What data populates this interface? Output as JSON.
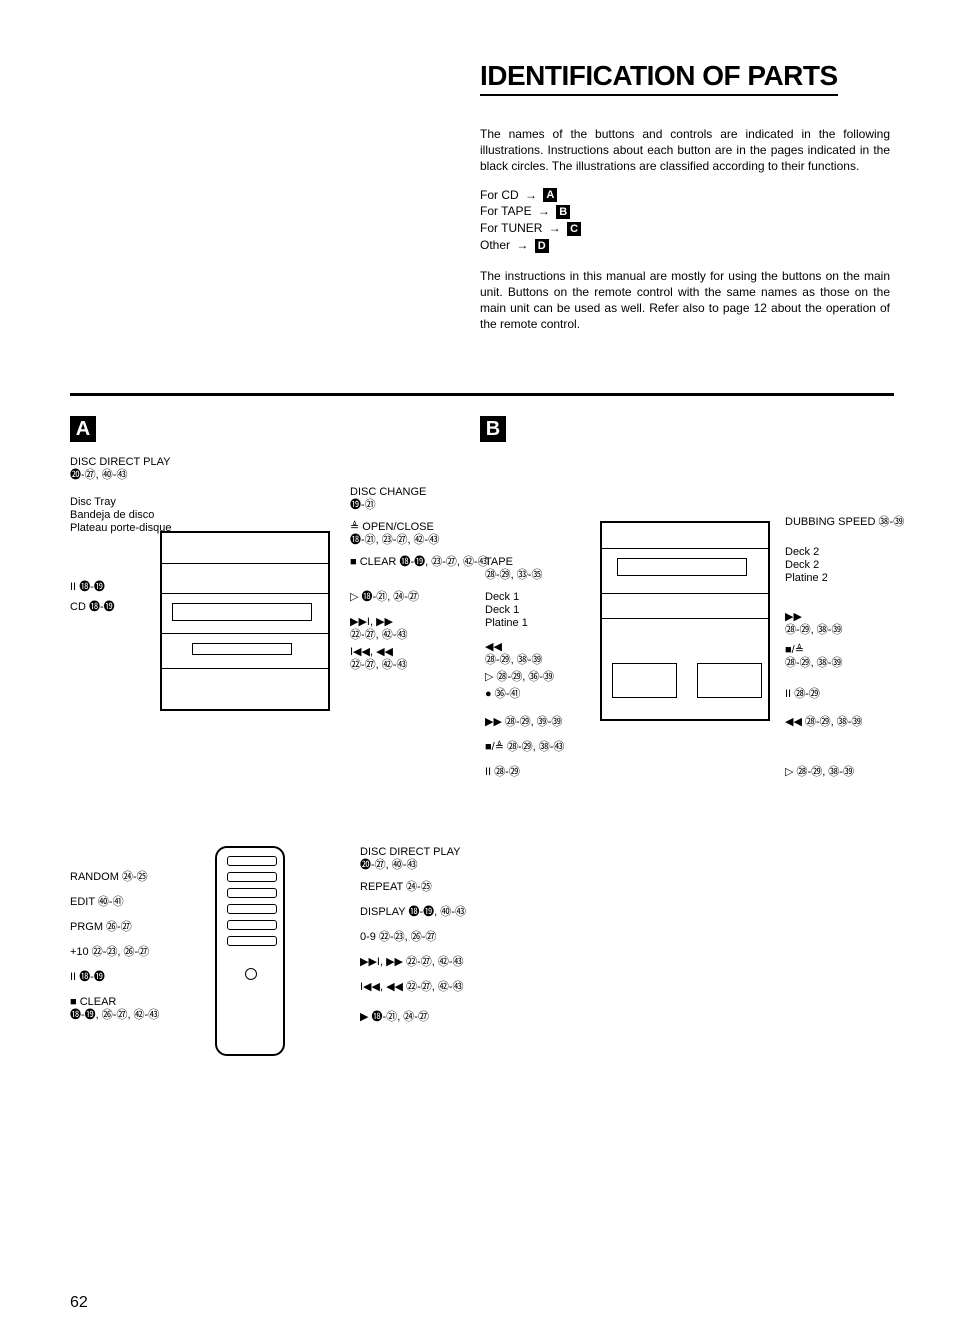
{
  "title": "IDENTIFICATION OF PARTS",
  "intro_p1": "The names of the buttons and controls are indicated in the following illustrations. Instructions about each button are in the pages indicated in the black circles. The illustrations are classified according to their functions.",
  "legend": {
    "cd": "For CD",
    "tape": "For TAPE",
    "tuner": "For TUNER",
    "other": "Other"
  },
  "intro_p2": "The instructions in this manual are mostly for using the buttons on the main unit. Buttons on the remote control with the same names as those on the main unit can be used as well. Refer also to page 12 about the operation of the remote control.",
  "sections": {
    "a": "A",
    "b": "B"
  },
  "labels_a": {
    "disc_direct_play": "DISC DIRECT PLAY",
    "disc_tray": "Disc Tray",
    "bandeja": "Bandeja de disco",
    "plateau": "Plateau porte-disque",
    "pause": "II",
    "cd": "CD",
    "disc_change": "DISC CHANGE",
    "open_close": "≜ OPEN/CLOSE",
    "clear": "■ CLEAR",
    "play": "▷",
    "ff": "▶▶I, ▶▶",
    "rw": "I◀◀, ◀◀"
  },
  "labels_b": {
    "tape": "TAPE",
    "deck1": "Deck 1",
    "deck1b": "Deck 1",
    "platine1": "Platine 1",
    "rw": "◀◀",
    "play": "▷",
    "rec": "●",
    "ff2": "▶▶",
    "stop_eject": "■/≜",
    "pause2": "II",
    "dubbing": "DUBBING SPEED",
    "deck2": "Deck 2",
    "deck2b": "Deck 2",
    "platine2": "Platine 2",
    "ff_r": "▶▶",
    "stop_r": "■/≜",
    "pause_r": "II",
    "rw_r": "◀◀",
    "play_r": "▷"
  },
  "labels_remote": {
    "random": "RANDOM",
    "edit": "EDIT",
    "prgm": "PRGM",
    "plus10": "+10",
    "pause": "II",
    "clear": "■ CLEAR",
    "ddp": "DISC DIRECT PLAY",
    "repeat": "REPEAT",
    "display": "DISPLAY",
    "num": "0-9",
    "ff": "▶▶I, ▶▶",
    "rw": "I◀◀, ◀◀",
    "play": "▶"
  },
  "page_refs": {
    "a_ddp": "⓴-㉗, ㊵-㊸",
    "a_pause": "⓲-⓳",
    "a_cd": "⓲-⓳",
    "a_dchange": "⓳-㉑",
    "a_openclose": "⓲-㉑, ㉓-㉗, ㊷-㊸",
    "a_clear": "⓲-⓳, ㉓-㉗, ㊷-㊸",
    "a_play": "⓲-㉑, ㉔-㉗",
    "a_ff": "㉒-㉗, ㊷-㊸",
    "a_rw": "㉒-㉗, ㊷-㊸",
    "b_tape": "㉘-㉙, ㉝-㉟",
    "b_rw": "㉘-㉙, ㊳-㊴",
    "b_play": "㉘-㉙, ㊱-㊴",
    "b_rec": "㊱-㊶",
    "b_ff2": "㉘-㉙, ㊴-㊴",
    "b_stop": "㉘-㉙, ㊳-㊸",
    "b_pause2": "㉘-㉙",
    "b_dub": "㊳-㊴",
    "b_ffr": "㉘-㉙, ㊳-㊴",
    "b_stopr": "㉘-㉙, ㊳-㊴",
    "b_pauser": "㉘-㉙",
    "b_rwr": "㉘-㉙, ㊳-㊴",
    "b_playr": "㉘-㉙, ㊳-㊴",
    "r_random": "㉔-㉕",
    "r_edit": "㊵-㊶",
    "r_prgm": "㉖-㉗",
    "r_p10": "㉒-㉓, ㉖-㉗",
    "r_pause": "⓲-⓳",
    "r_clear": "⓲-⓳, ㉖-㉗, ㊷-㊸",
    "r_ddp": "⓴-㉗, ㊵-㊸",
    "r_repeat": "㉔-㉕",
    "r_display": "⓲-⓳, ㊵-㊸",
    "r_num": "㉒-㉓, ㉖-㉗",
    "r_ff": "㉒-㉗, ㊷-㊸",
    "r_rw": "㉒-㉗, ㊷-㊸",
    "r_play": "⓲-㉑, ㉔-㉗"
  },
  "page_number": "62"
}
